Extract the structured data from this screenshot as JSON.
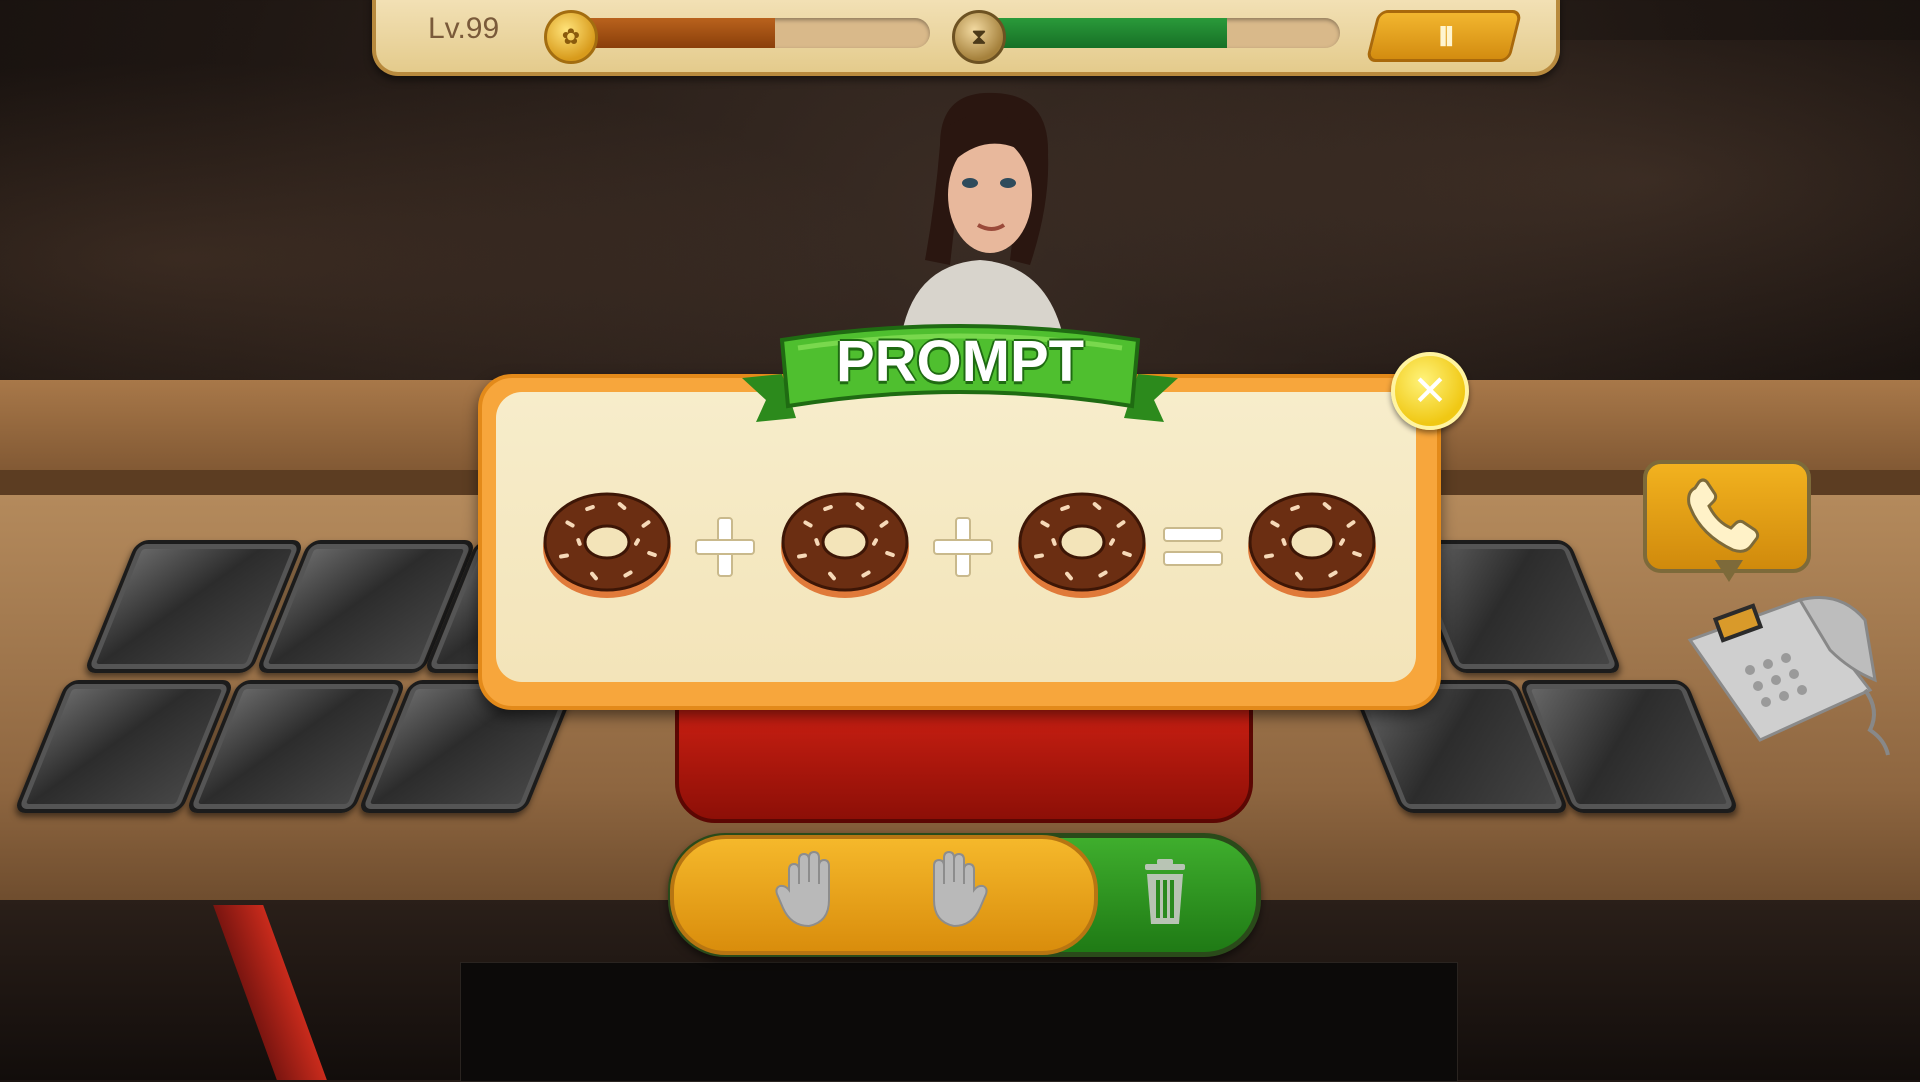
{
  "hud": {
    "level": "Lv.99",
    "coin_progress": 0.58,
    "time_progress": 0.69,
    "pause_label": "II"
  },
  "prompt": {
    "title": "PROMPT",
    "close_label": "✕",
    "recipe": [
      "donut",
      "plus",
      "donut",
      "plus",
      "donut",
      "equals",
      "donut"
    ]
  },
  "colors": {
    "ribbon_green": "#3fae2d",
    "dialog_orange": "#f7a63c",
    "dialog_cream": "#f7edcb",
    "action_orange": "#f5b82b",
    "action_green": "#2a9a22"
  },
  "icons": {
    "coin": "coin-icon",
    "time": "hourglass-icon",
    "pause": "pause-icon",
    "close": "close-icon",
    "hand_left": "hand-icon",
    "hand_right": "hand-icon",
    "trash": "trash-icon",
    "phone": "phone-icon"
  }
}
